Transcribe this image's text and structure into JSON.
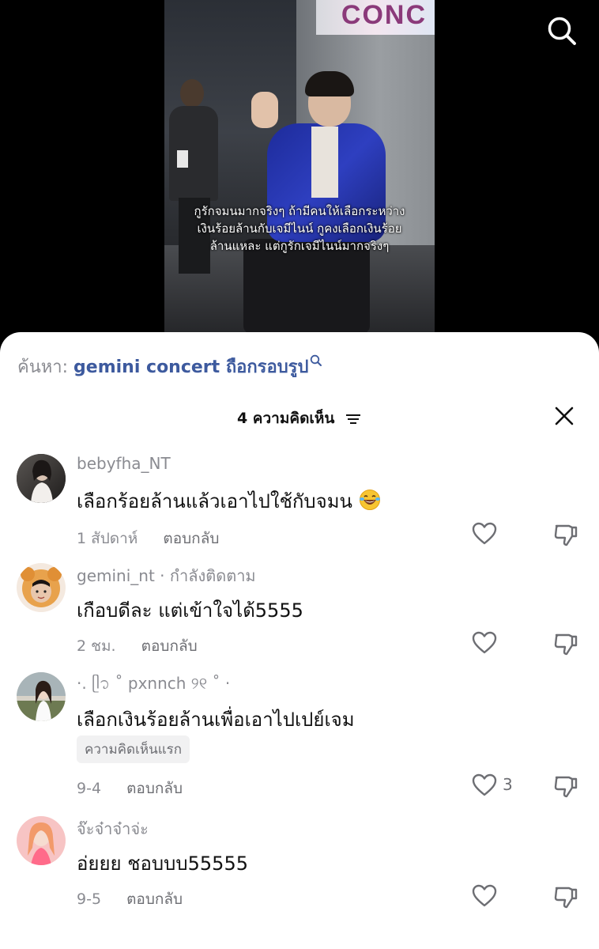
{
  "video": {
    "banner_text": "CONC",
    "caption_lines": [
      "กูรักจมนมากจริงๆ ถ้ามีคนให้เลือกระหว่าง",
      "เงินร้อยล้านกับเจมีไนน์ กูคงเลือกเงินร้อย",
      "ล้านแหละ แต่กูรักเจมีไนน์มากจริงๆ"
    ]
  },
  "search": {
    "prefix": "ค้นหา:",
    "term": "gemini concert ถือกรอบรูป"
  },
  "comments_header": {
    "count_label": "4 ความคิดเห็น"
  },
  "comments": [
    {
      "username": "bebyfha_NT",
      "text": "เลือกร้อยล้านแล้วเอาไปใช้กับจมน",
      "emoji": "laughing-with-tears-emoji",
      "time": "1 สัปดาห์",
      "reply_label": "ตอบกลับ",
      "likes": ""
    },
    {
      "username": "gemini_nt · กำลังติดตาม",
      "text": "เกือบดีละ แต่เข้าใจได้5555",
      "time": "2 ชม.",
      "reply_label": "ตอบกลับ",
      "likes": ""
    },
    {
      "username": "·. ᥫ᭡ ˚ pxnnch ୨୧ ˚ ·",
      "text": "เลือกเงินร้อยล้านเพื่อเอาไปเปย์เจม",
      "badge": "ความคิดเห็นแรก",
      "time": "9-4",
      "reply_label": "ตอบกลับ",
      "likes": "3"
    },
    {
      "username": "จ๊ะจ๋าจ๋าจ่ะ",
      "text": "อ่ยยย ชอบบบ55555",
      "time": "9-5",
      "reply_label": "ตอบกลับ",
      "likes": ""
    }
  ],
  "colors": {
    "search_term": "#3d5a9e",
    "muted_text": "#8a8b91",
    "sheet_background": "#ffffff"
  }
}
